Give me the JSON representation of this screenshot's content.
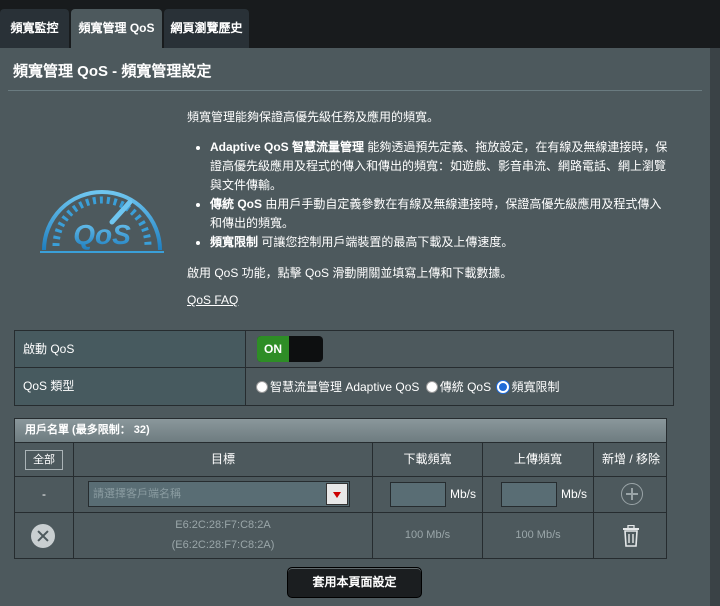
{
  "tabs": [
    {
      "label": "頻寬監控"
    },
    {
      "label": "頻寬管理 QoS"
    },
    {
      "label": "網頁瀏覽歷史"
    }
  ],
  "page": {
    "title": "頻寬管理 QoS - 頻寬管理設定",
    "logo_text": "QoS",
    "intro": "頻寬管理能夠保證高優先級任務及應用的頻寬。",
    "bullets": [
      {
        "bold": "Adaptive QoS 智慧流量管理",
        "text": " 能夠透過預先定義、拖放設定，在有線及無線連接時，保證高優先級應用及程式的傳入和傳出的頻寬：如遊戲、影音串流、網路電話、網上瀏覽與文件傳輸。"
      },
      {
        "bold": "傳統 QoS",
        "text": " 由用戶手動自定義參數在有線及無線連接時，保證高優先級應用及程式傳入和傳出的頻寬。"
      },
      {
        "bold": "頻寬限制",
        "text": " 可讓您控制用戶端裝置的最高下載及上傳速度。"
      }
    ],
    "enable_text": "啟用 QoS 功能，點擊 QoS 滑動開關並填寫上傳和下載數據。",
    "faq_link": "QoS FAQ"
  },
  "settings": {
    "enable_label": "啟動 QoS",
    "toggle_on": "ON",
    "type_label": "QoS 類型",
    "type_options": [
      {
        "label": "智慧流量管理 Adaptive QoS",
        "checked": false
      },
      {
        "label": "傳統 QoS",
        "checked": false
      },
      {
        "label": "頻寬限制",
        "checked": true
      }
    ]
  },
  "client_list": {
    "header": "用戶名單 (最多限制： 32)",
    "all_button": "全部",
    "columns": [
      "目標",
      "下載頻寬",
      "上傳頻寬",
      "新增 / 移除"
    ],
    "input_row": {
      "dash": "-",
      "select_placeholder": "請選擇客戶端名稱",
      "download_value": "",
      "upload_value": "",
      "unit": "Mb/s"
    },
    "rows": [
      {
        "mac": "E6:2C:28:F7:C8:2A",
        "mac_sub": "(E6:2C:28:F7:C8:2A)",
        "download": "100 Mb/s",
        "upload": "100 Mb/s"
      }
    ]
  },
  "apply_button": "套用本頁面設定",
  "colors": {
    "accent_blue": "#3a9fd8",
    "toggle_green": "#2e8d26",
    "radio_blue": "#1e6ad8"
  }
}
